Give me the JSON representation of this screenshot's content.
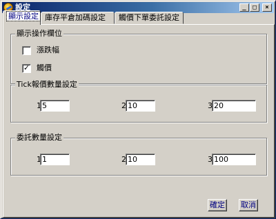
{
  "window": {
    "title": "設定",
    "minimize_glyph": "_",
    "maximize_glyph": "□",
    "close_glyph": "×"
  },
  "tabs": [
    {
      "label": "顯示設定",
      "active": true
    },
    {
      "label": "庫存平倉加碼設定",
      "active": false
    },
    {
      "label": "觸價下單委託設定",
      "active": false
    }
  ],
  "display_columns": {
    "legend": "顯示操作欄位",
    "items": [
      {
        "label": "漲跌幅",
        "checked": false,
        "mark": ""
      },
      {
        "label": "觸價",
        "checked": true,
        "mark": "✓"
      }
    ]
  },
  "tick_quantity": {
    "legend": "Tick報價數量設定",
    "fields": [
      {
        "label": "1",
        "value": "5"
      },
      {
        "label": "2",
        "value": "10"
      },
      {
        "label": "3",
        "value": "20"
      }
    ]
  },
  "order_quantity": {
    "legend": "委託數量設定",
    "fields": [
      {
        "label": "1",
        "value": "1"
      },
      {
        "label": "2",
        "value": "10"
      },
      {
        "label": "3",
        "value": "100"
      }
    ]
  },
  "buttons": {
    "ok": "確定",
    "cancel": "取消"
  }
}
